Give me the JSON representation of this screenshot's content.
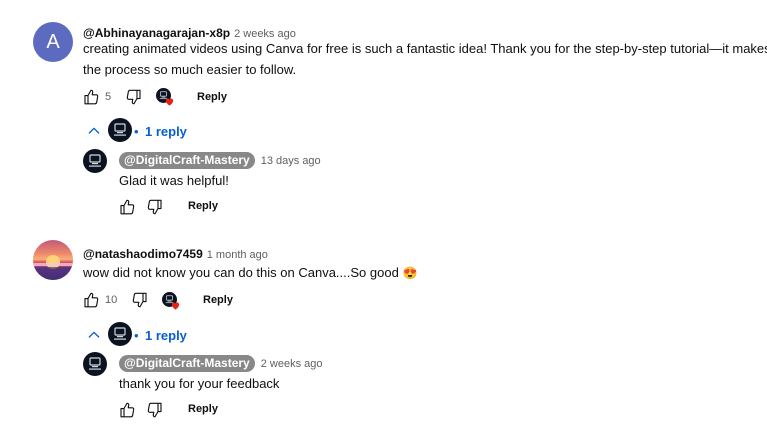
{
  "comments": [
    {
      "author": "@Abhinayanagarajan-x8p",
      "time": "2 weeks ago",
      "avatar_letter": "A",
      "text_line1": "creating animated videos using Canva for free is such a fantastic idea!  Thank you for the step-by-step tutorial—it makes",
      "text_line2": "the process so much easier to follow.",
      "likes": "5",
      "reply_label": "Reply",
      "replies_link": "1 reply",
      "reply": {
        "author": "@DigitalCraft-Mastery",
        "time": "13 days ago",
        "text": "Glad it was helpful!",
        "reply_label": "Reply"
      }
    },
    {
      "author": "@natashaodimo7459",
      "time": "1 month ago",
      "text": "wow did not know you can do this on Canva....So good",
      "emoji": "😍",
      "likes": "10",
      "reply_label": "Reply",
      "replies_link": "1 reply",
      "reply": {
        "author": "@DigitalCraft-Mastery",
        "time": "2 weeks ago",
        "text": "thank you for your feedback",
        "reply_label": "Reply"
      }
    }
  ],
  "colors": {
    "link": "#065fd4",
    "chip": "#888888",
    "heart": "#e62117",
    "avatar_a": "#5c6bc0"
  }
}
